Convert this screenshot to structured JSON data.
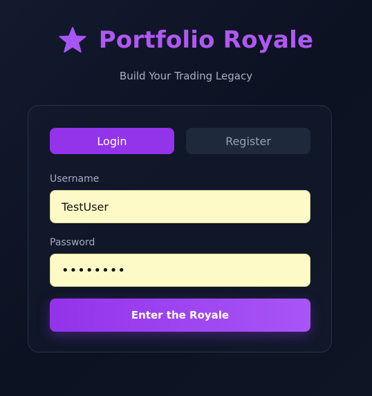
{
  "app": {
    "title": "Portfolio Royale",
    "tagline": "Build Your Trading Legacy",
    "logo_icon": "star-icon"
  },
  "auth": {
    "tabs": [
      {
        "label": "Login",
        "active": true
      },
      {
        "label": "Register",
        "active": false
      }
    ],
    "username_label": "Username",
    "username_value": "TestUser",
    "password_label": "Password",
    "password_value": "password",
    "submit_label": "Enter the Royale"
  },
  "colors": {
    "accent": "#9333ea",
    "accent_light": "#a855f7",
    "title": "#b058f3",
    "background": "#0f1525",
    "input_bg": "#fefac8",
    "inactive_tab": "#1e293b"
  }
}
